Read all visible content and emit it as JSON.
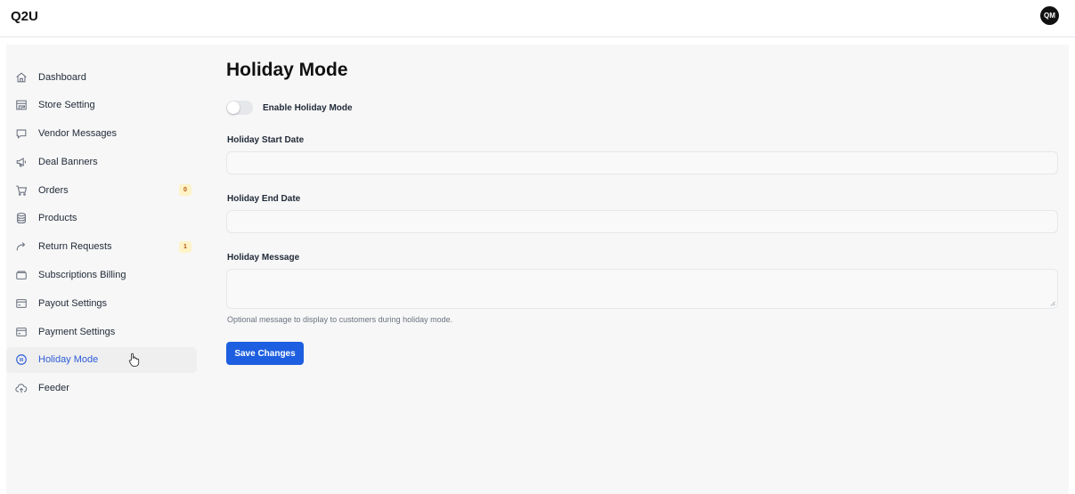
{
  "header": {
    "logo": "Q2U",
    "avatar_initials": "QM"
  },
  "sidebar": {
    "items": [
      {
        "label": "Dashboard",
        "icon": "home-icon"
      },
      {
        "label": "Store Setting",
        "icon": "store-icon"
      },
      {
        "label": "Vendor Messages",
        "icon": "message-icon"
      },
      {
        "label": "Deal Banners",
        "icon": "megaphone-icon"
      },
      {
        "label": "Orders",
        "icon": "cart-icon",
        "badge": "0"
      },
      {
        "label": "Products",
        "icon": "database-icon"
      },
      {
        "label": "Return Requests",
        "icon": "return-arrow-icon",
        "badge": "1"
      },
      {
        "label": "Subscriptions Billing",
        "icon": "wallet-icon"
      },
      {
        "label": "Payout Settings",
        "icon": "card-icon"
      },
      {
        "label": "Payment Settings",
        "icon": "card-icon"
      },
      {
        "label": "Holiday Mode",
        "icon": "pause-circle-icon",
        "active": true
      },
      {
        "label": "Feeder",
        "icon": "upload-cloud-icon"
      }
    ]
  },
  "main": {
    "title": "Holiday Mode",
    "toggle_label": "Enable Holiday Mode",
    "toggle_on": false,
    "start_label": "Holiday Start Date",
    "start_value": "",
    "end_label": "Holiday End Date",
    "end_value": "",
    "message_label": "Holiday Message",
    "message_value": "",
    "message_help": "Optional message to display to customers during holiday mode.",
    "save_label": "Save Changes"
  },
  "colors": {
    "accent": "#1d5fe0",
    "active_nav_text": "#2d5bd8",
    "badge_bg": "#fef3c7",
    "badge_text": "#b45309"
  }
}
